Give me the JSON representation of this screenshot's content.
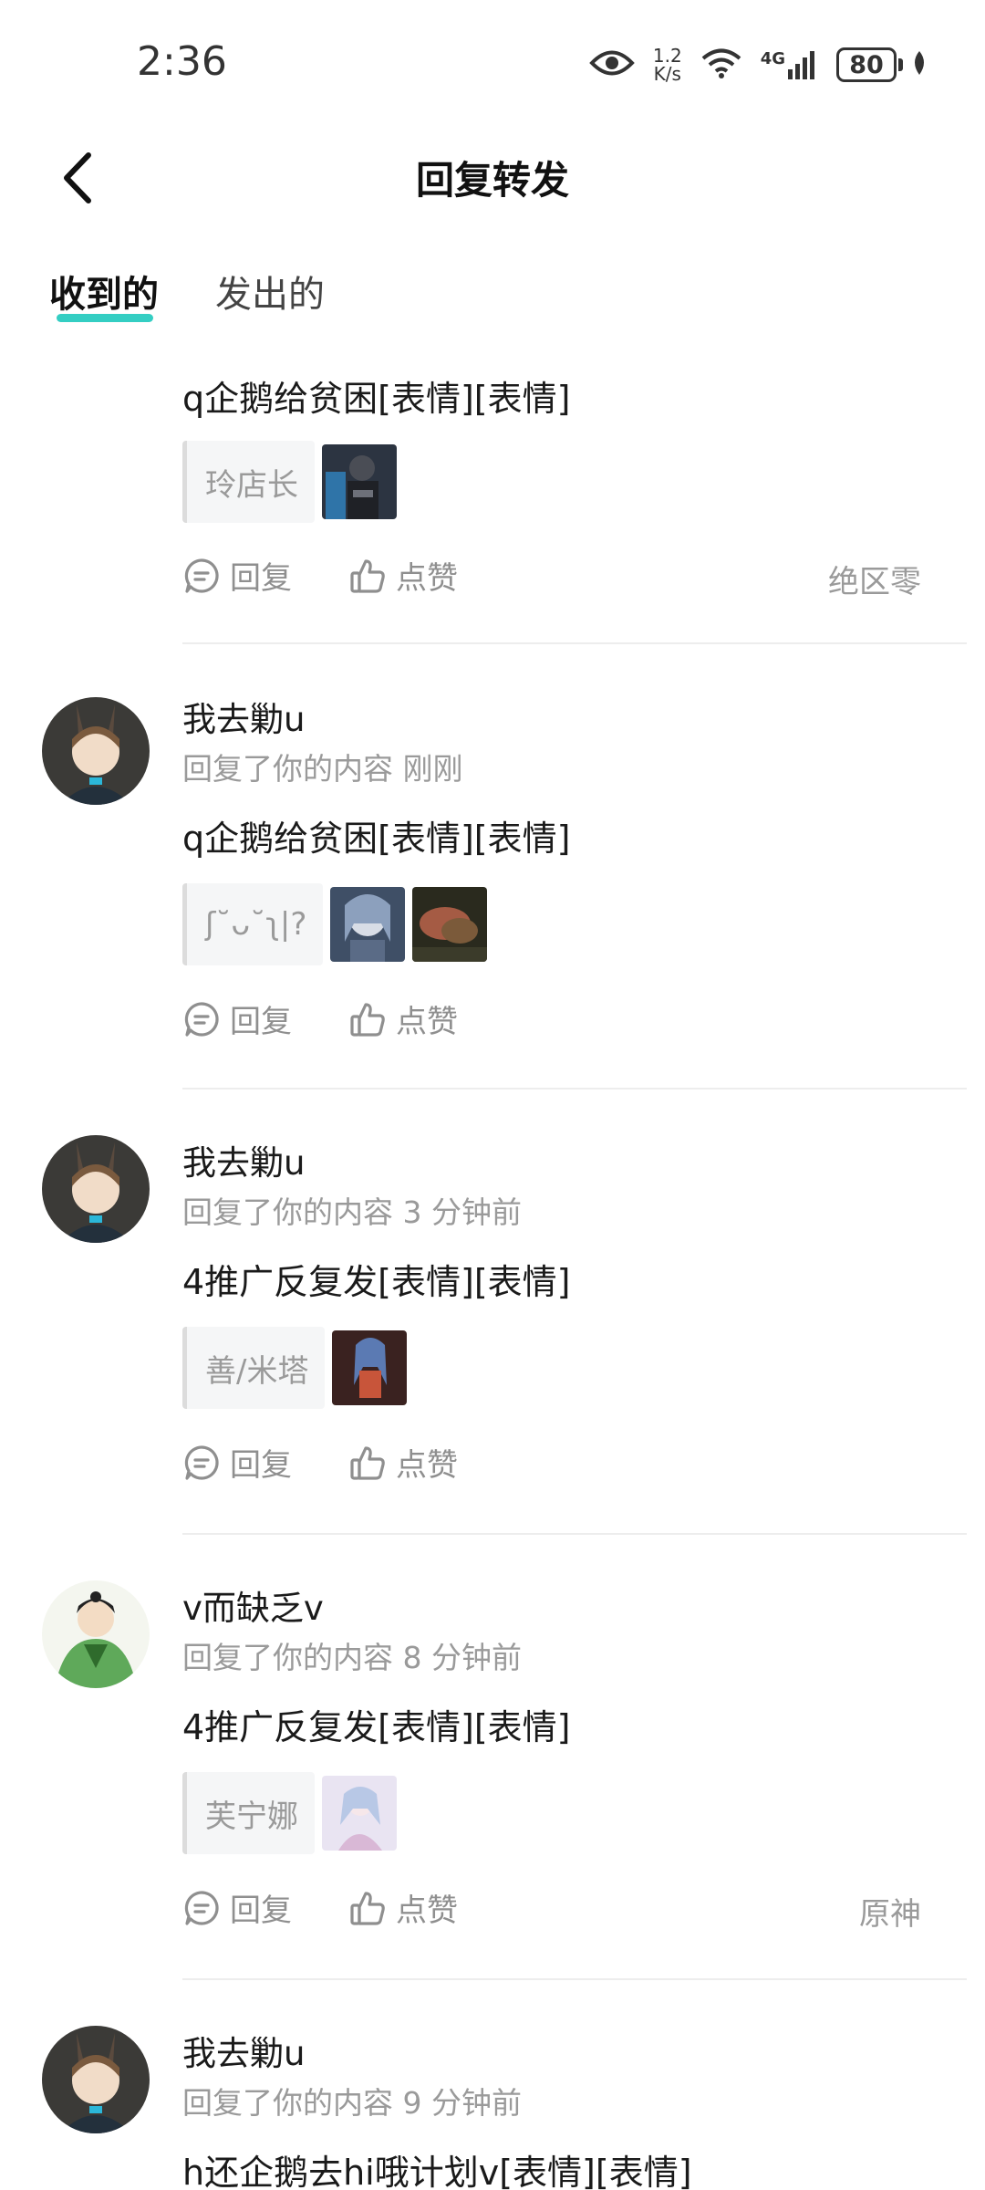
{
  "status_bar": {
    "time": "2:36",
    "net_speed_value": "1.2",
    "net_speed_unit": "K/s",
    "network": "4G",
    "battery": "80"
  },
  "header": {
    "title": "回复转发"
  },
  "tabs": {
    "received": "收到的",
    "sent": "发出的"
  },
  "actions": {
    "reply": "回复",
    "like": "点赞"
  },
  "colors": {
    "accent": "#1ec9bd",
    "muted_text": "#9a9a9a"
  },
  "items": [
    {
      "content": "q企鹅给贫困[表情][表情]",
      "quote": "玲店长",
      "tag": "绝区零"
    },
    {
      "username": "我去勦u",
      "meta": "回复了你的内容 刚刚",
      "content": "q企鹅给贫困[表情][表情]",
      "quote": "ʃ˘ᴗ˘ʅ|?"
    },
    {
      "username": "我去勦u",
      "meta": "回复了你的内容 3 分钟前",
      "content": "4推广反复发[表情][表情]",
      "quote": "善/米塔"
    },
    {
      "username": "v而缺乏v",
      "meta": "回复了你的内容 8 分钟前",
      "content": "4推广反复发[表情][表情]",
      "quote": "芙宁娜",
      "tag": "原神"
    },
    {
      "username": "我去勦u",
      "meta": "回复了你的内容 9 分钟前",
      "content": "h还企鹅去hi哦计划v[表情][表情]"
    }
  ]
}
